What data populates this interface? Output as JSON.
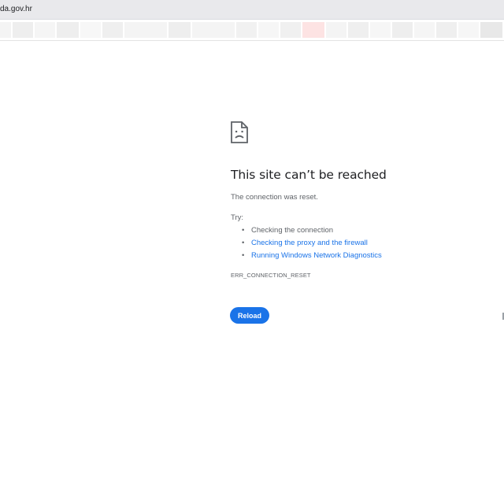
{
  "browser": {
    "url": "da.gov.hr"
  },
  "error_page": {
    "icon": "sad-document-icon",
    "title": "This site can’t be reached",
    "description": "The connection was reset.",
    "try_label": "Try:",
    "suggestions": [
      {
        "label": "Checking the connection",
        "is_link": false
      },
      {
        "label": "Checking the proxy and the firewall",
        "is_link": true
      },
      {
        "label": "Running Windows Network Diagnostics",
        "is_link": true
      }
    ],
    "error_code": "ERR_CONNECTION_RESET",
    "reload_label": "Reload"
  },
  "colors": {
    "link": "#1a73e8",
    "button": "#1a73e8",
    "text_primary": "#202124",
    "text_secondary": "#5f6368"
  }
}
